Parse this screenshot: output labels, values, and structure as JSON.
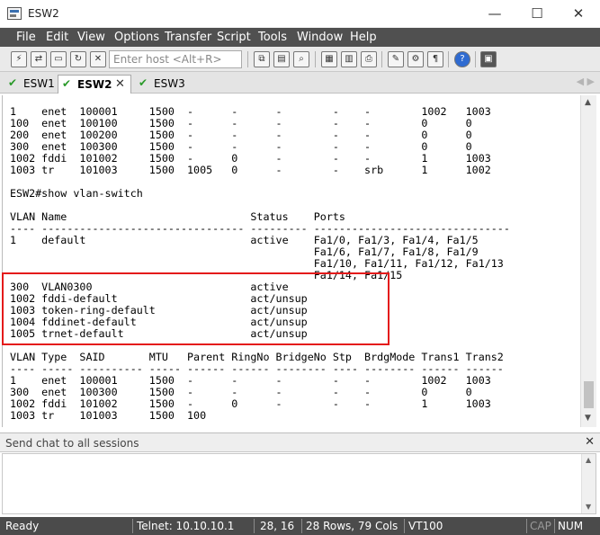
{
  "window": {
    "title": "ESW2",
    "controls": {
      "minimize": "—",
      "maximize": "☐",
      "close": "✕"
    }
  },
  "menu": [
    "File",
    "Edit",
    "View",
    "Options",
    "Transfer",
    "Script",
    "Tools",
    "Window",
    "Help"
  ],
  "toolbar": {
    "host_placeholder": "Enter host <Alt+R>"
  },
  "tabs": [
    {
      "label": "ESW1",
      "active": false
    },
    {
      "label": "ESW2",
      "active": true
    },
    {
      "label": "ESW3",
      "active": false
    }
  ],
  "terminal": {
    "lines": [
      "1    enet  100001     1500  -      -      -        -    -        1002   1003",
      "100  enet  100100     1500  -      -      -        -    -        0      0",
      "200  enet  100200     1500  -      -      -        -    -        0      0",
      "300  enet  100300     1500  -      -      -        -    -        0      0",
      "1002 fddi  101002     1500  -      0      -        -    -        1      1003",
      "1003 tr    101003     1500  1005   0      -        -    srb      1      1002",
      "",
      "ESW2#show vlan-switch",
      "",
      "VLAN Name                             Status    Ports",
      "---- -------------------------------- --------- -------------------------------",
      "1    default                          active    Fa1/0, Fa1/3, Fa1/4, Fa1/5",
      "                                                Fa1/6, Fa1/7, Fa1/8, Fa1/9",
      "                                                Fa1/10, Fa1/11, Fa1/12, Fa1/13",
      "                                                Fa1/14, Fa1/15",
      "300  VLAN0300                         active",
      "1002 fddi-default                     act/unsup",
      "1003 token-ring-default               act/unsup",
      "1004 fddinet-default                  act/unsup",
      "1005 trnet-default                    act/unsup",
      "",
      "VLAN Type  SAID       MTU   Parent RingNo BridgeNo Stp  BrdgMode Trans1 Trans2",
      "---- ----- ---------- ----- ------ ------ -------- ---- -------- ------ ------",
      "1    enet  100001     1500  -      -      -        -    -        1002   1003",
      "300  enet  100300     1500  -      -      -        -    -        0      0",
      "1002 fddi  101002     1500  -      0      -        -    -        1      1003",
      "1003 tr    101003     1500  100"
    ]
  },
  "chat": {
    "label": "Send chat to all sessions",
    "close": "✕"
  },
  "status": {
    "ready": "Ready",
    "connection": "Telnet: 10.10.10.1",
    "cursor": "28,  16",
    "size": "28 Rows, 79 Cols",
    "emulation": "VT100",
    "cap": "CAP",
    "num": "NUM"
  },
  "colors": {
    "menubar": "#505050",
    "statusbar": "#4b4b4b",
    "highlight": "#e41b1b",
    "tab_check": "#2a9a2a"
  }
}
